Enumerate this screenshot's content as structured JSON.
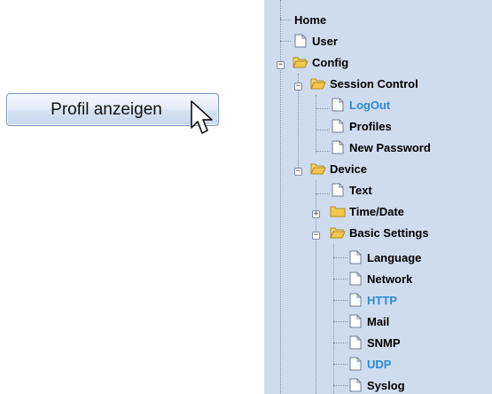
{
  "button": {
    "label": "Profil anzeigen"
  },
  "tree": {
    "home": "Home",
    "user": "User",
    "config": "Config",
    "session_control": "Session Control",
    "logout": "LogOut",
    "profiles": "Profiles",
    "new_password": "New Password",
    "device": "Device",
    "text": "Text",
    "time_date": "Time/Date",
    "basic_settings": "Basic Settings",
    "language": "Language",
    "network": "Network",
    "http": "HTTP",
    "mail": "Mail",
    "snmp": "SNMP",
    "udp": "UDP",
    "syslog": "Syslog"
  },
  "colors": {
    "panel_bg": "#cfdcee",
    "link": "#2c8ad6",
    "folder": "#f3c84b"
  },
  "icons": [
    "document-icon",
    "folder-open-icon",
    "folder-closed-icon",
    "expand-icon",
    "collapse-icon",
    "mouse-pointer-icon"
  ]
}
